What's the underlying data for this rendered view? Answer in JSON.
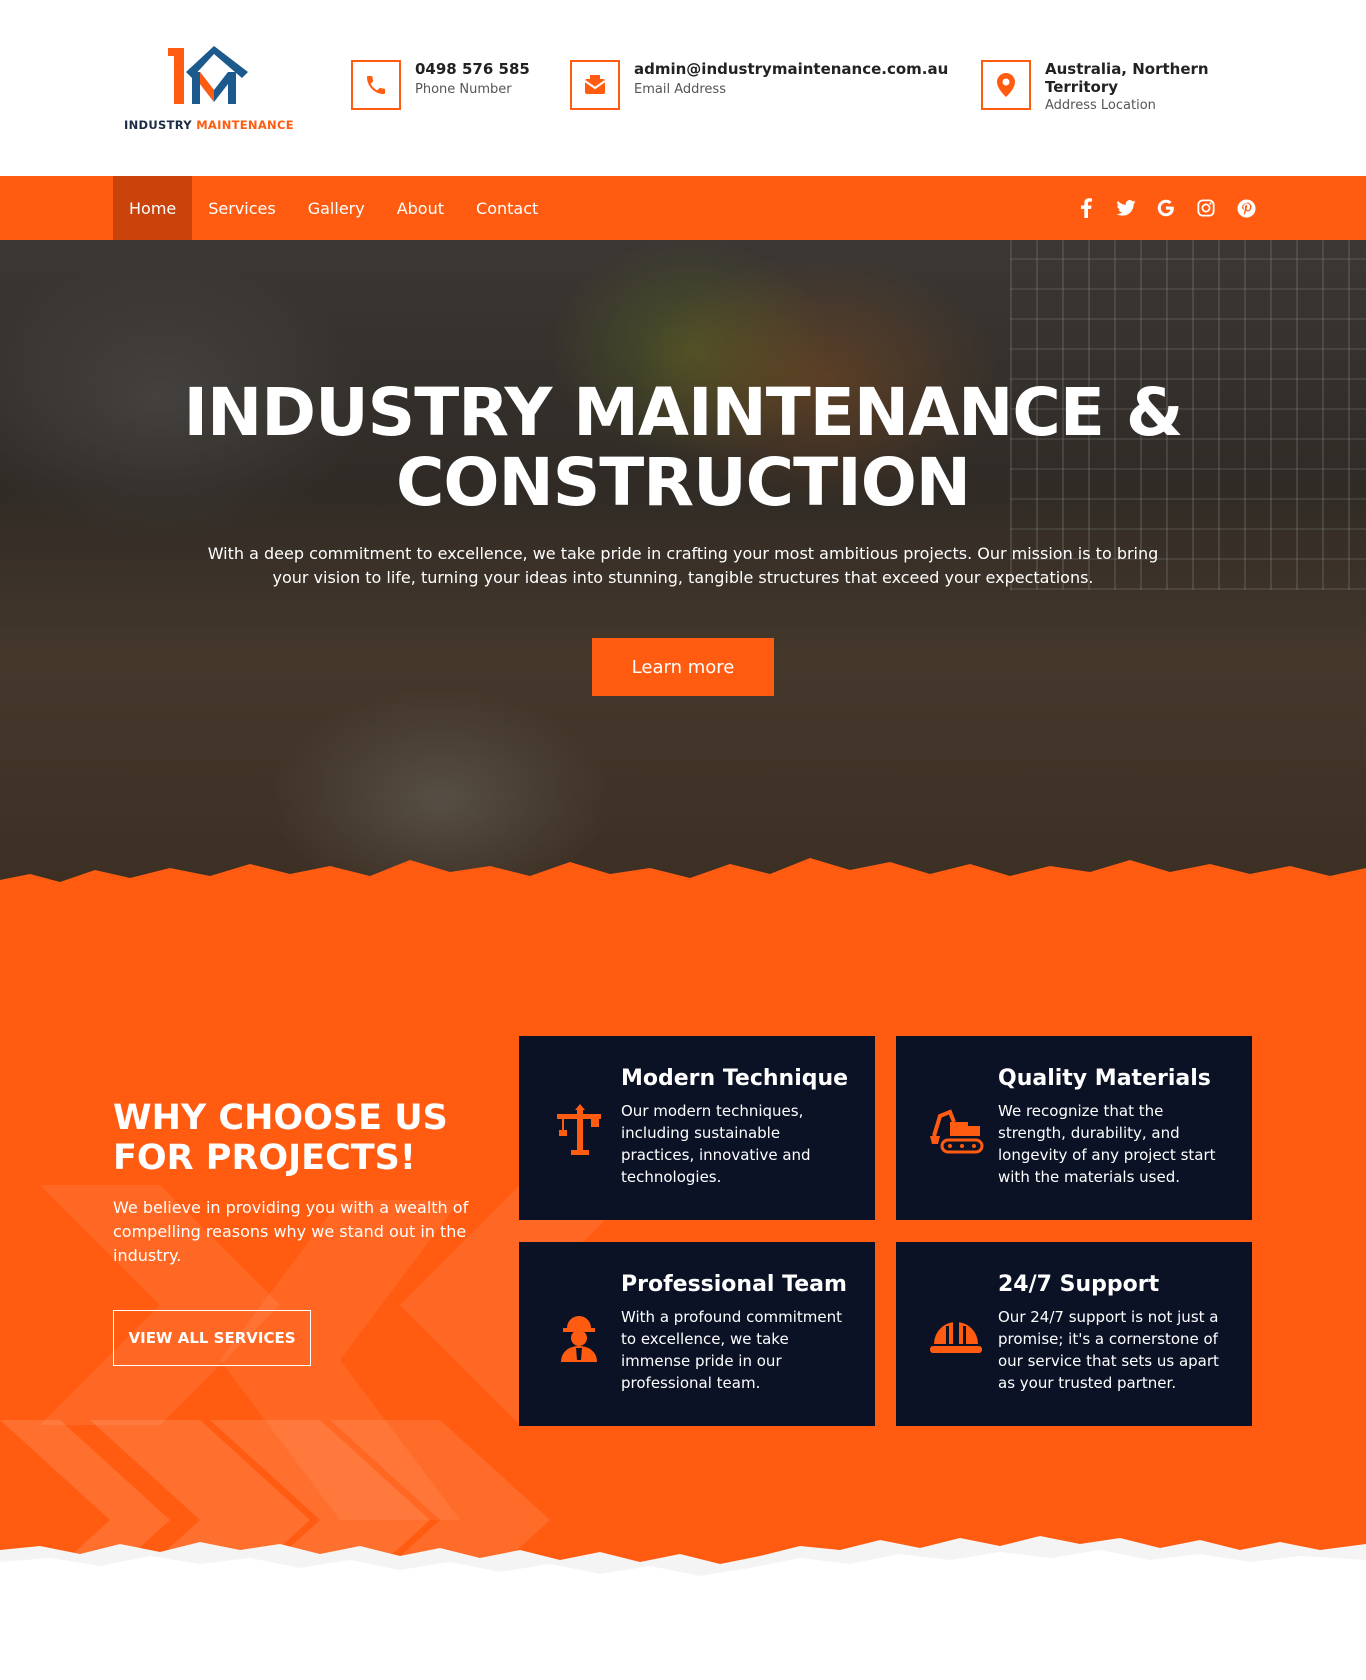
{
  "logo": {
    "text_main": "INDUSTRY",
    "text_accent": "MAINTENANCE"
  },
  "contacts": [
    {
      "value": "0498 576 585",
      "label": "Phone Number",
      "icon": "phone-icon"
    },
    {
      "value": "admin@industrymaintenance.com.au",
      "label": "Email Address",
      "icon": "email-icon"
    },
    {
      "value": "Australia, Northern Territory",
      "label": "Address Location",
      "icon": "location-pin-icon"
    }
  ],
  "nav": {
    "items": [
      {
        "label": "Home",
        "active": true
      },
      {
        "label": "Services"
      },
      {
        "label": "Gallery"
      },
      {
        "label": "About"
      },
      {
        "label": "Contact"
      }
    ],
    "social": [
      "f",
      "t",
      "G",
      "ig",
      "p"
    ]
  },
  "hero": {
    "title_line1": "INDUSTRY MAINTENANCE &",
    "title_line2": "CONSTRUCTION",
    "subtitle": "With a deep commitment to excellence, we take pride in crafting your most ambitious projects. Our mission is to bring your vision to life, turning your ideas into stunning, tangible structures that exceed your expectations.",
    "button": "Learn more"
  },
  "why": {
    "title": "WHY CHOOSE US FOR PROJECTS!",
    "text": "We believe in providing you with a wealth of compelling reasons why we stand out in the industry.",
    "button": "VIEW ALL SERVICES",
    "features": [
      {
        "title": "Modern Technique",
        "desc": "Our modern techniques, including sustainable practices, innovative and technologies.",
        "icon": "crane-icon"
      },
      {
        "title": "Quality Materials",
        "desc": "We recognize that the strength, durability, and longevity of any project start with the materials used.",
        "icon": "excavator-icon"
      },
      {
        "title": "Professional Team",
        "desc": "With a profound commitment to excellence, we take immense pride in our professional team.",
        "icon": "worker-icon"
      },
      {
        "title": "24/7 Support",
        "desc": "Our 24/7 support is not just a promise; it's a cornerstone of our service that sets us apart as your trusted partner.",
        "icon": "hard-hat-icon"
      }
    ]
  },
  "colors": {
    "accent": "#ff5c12",
    "dark": "#0b1226",
    "nav_active": "#c9430b",
    "logo_blue": "#1c5a8e"
  }
}
